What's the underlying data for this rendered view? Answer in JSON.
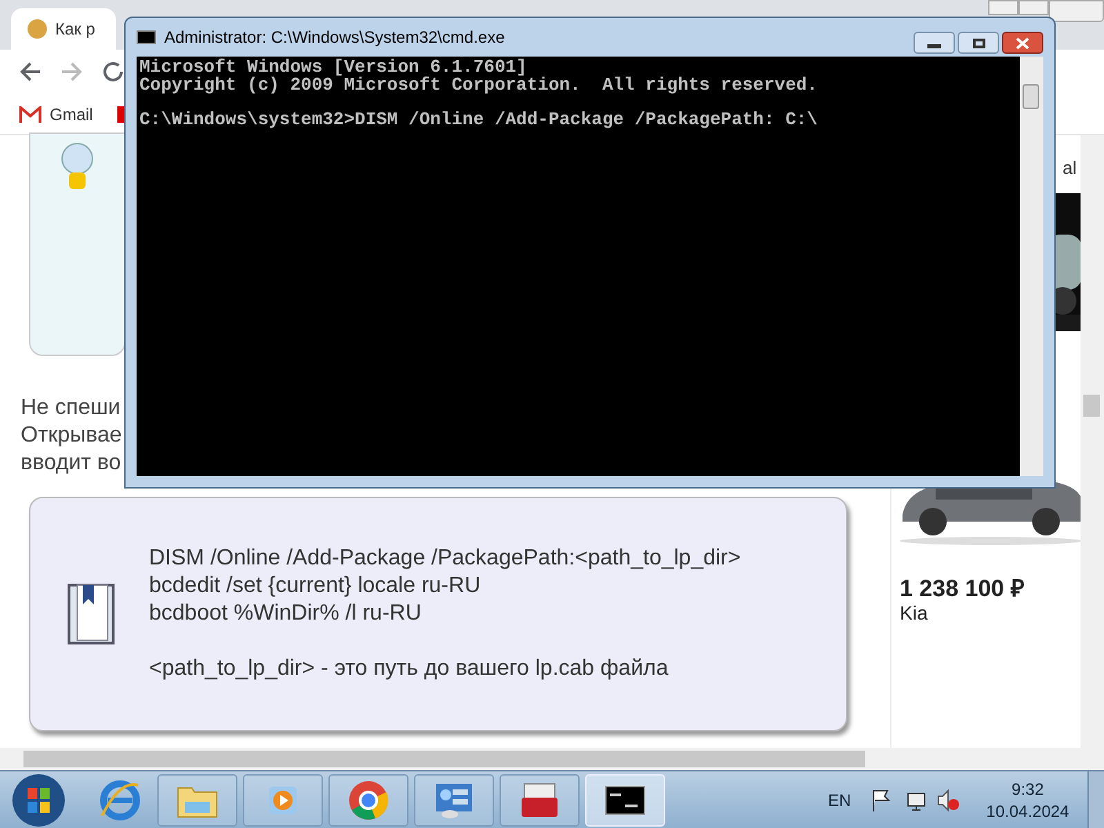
{
  "browser": {
    "tabs": [
      {
        "title": "Как р",
        "selected": true
      }
    ],
    "bookmarks": [
      {
        "label": "Gmail"
      }
    ]
  },
  "page": {
    "paragraph_lines": [
      "Не спеши",
      "Открывае",
      "вводит во"
    ],
    "code_card": {
      "lines": [
        "DISM /Online /Add-Package /PackagePath:<path_to_lp_dir>",
        "bcdedit /set {current} locale ru-RU",
        "bcdboot %WinDir% /l ru-RU"
      ],
      "note": "<path_to_lp_dir> - это путь до вашего lp.cab файла"
    },
    "ad": {
      "label_fragment": "al",
      "price": "1 238 100 ₽",
      "brand": "Kia"
    }
  },
  "console_window": {
    "title": "Administrator: C:\\Windows\\System32\\cmd.exe",
    "lines": [
      {
        "text": "Microsoft Windows [Version 6.1.7601]",
        "blank_before": false
      },
      {
        "text": "Copyright (c) 2009 Microsoft Corporation.  All rights reserved.",
        "blank_before": false
      },
      {
        "text": "C:\\Windows\\system32>DISM /Online /Add-Package /PackagePath: C:\\",
        "blank_before": true
      }
    ]
  },
  "taskbar": {
    "apps": [
      {
        "kind": "explorer",
        "selected": false
      },
      {
        "kind": "media",
        "selected": false
      },
      {
        "kind": "chrome",
        "selected": false
      },
      {
        "kind": "control",
        "selected": false
      },
      {
        "kind": "toolbox",
        "selected": false
      },
      {
        "kind": "console",
        "selected": true
      }
    ],
    "language": "EN",
    "time": "9:32",
    "date": "10.04.2024"
  }
}
